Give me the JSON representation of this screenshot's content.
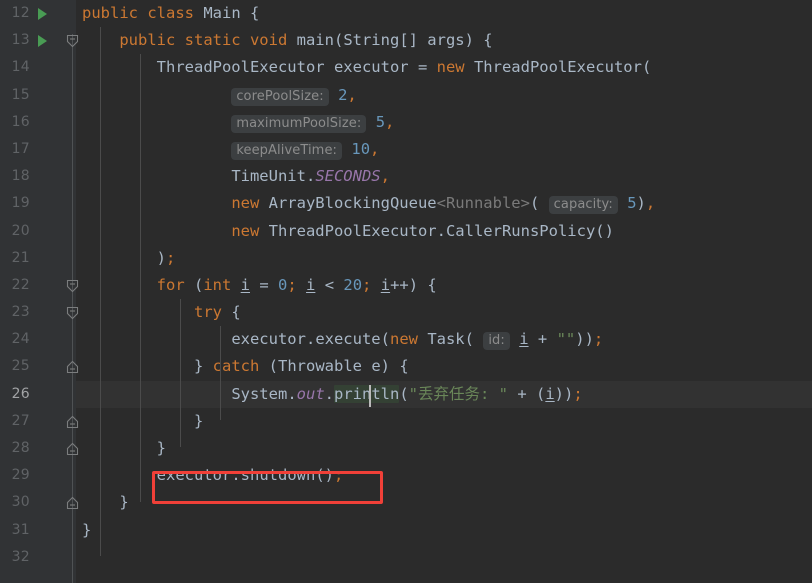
{
  "editor": {
    "language": "Java",
    "theme": "Darcula",
    "background": "#2b2b2b",
    "gutter_background": "#313335",
    "current_line_number": 26,
    "caret": {
      "line": 26,
      "column_char_index": 31,
      "after_text": "System.out.p"
    },
    "colors": {
      "keyword": "#cc7832",
      "identifier": "#a9b7c6",
      "number": "#6897bb",
      "string": "#6a8759",
      "static_field": "#9876aa",
      "generic_dim": "#7a7a7a",
      "hint_text": "#8c8c8c",
      "hint_bg": "#3c3f41",
      "line_number": "#606366",
      "current_line_number": "#a1a3a5",
      "current_line_bg": "#323232",
      "run_marker_green": "#499c54",
      "annotation_red": "#f04038",
      "indent_guide": "#4b4b4b"
    },
    "annotation": {
      "name": "red-rectangle-highlight",
      "target_line": 29,
      "target_text": "executor.shutdown();",
      "color": "#f04038"
    },
    "lines": [
      {
        "n": "12",
        "run_marker": true,
        "fold": "none",
        "text": "public class Main {"
      },
      {
        "n": "13",
        "run_marker": true,
        "fold": "start",
        "text": "    public static void main(String[] args) {"
      },
      {
        "n": "14",
        "run_marker": false,
        "fold": "none",
        "text": "        ThreadPoolExecutor executor = new ThreadPoolExecutor("
      },
      {
        "n": "15",
        "run_marker": false,
        "fold": "none",
        "text": "                corePoolSize: 2,"
      },
      {
        "n": "16",
        "run_marker": false,
        "fold": "none",
        "text": "                maximumPoolSize: 5,"
      },
      {
        "n": "17",
        "run_marker": false,
        "fold": "none",
        "text": "                keepAliveTime: 10,"
      },
      {
        "n": "18",
        "run_marker": false,
        "fold": "none",
        "text": "                TimeUnit.SECONDS,"
      },
      {
        "n": "19",
        "run_marker": false,
        "fold": "none",
        "text": "                new ArrayBlockingQueue<Runnable>( capacity: 5),"
      },
      {
        "n": "20",
        "run_marker": false,
        "fold": "none",
        "text": "                new ThreadPoolExecutor.CallerRunsPolicy()"
      },
      {
        "n": "21",
        "run_marker": false,
        "fold": "none",
        "text": "        );"
      },
      {
        "n": "22",
        "run_marker": false,
        "fold": "start",
        "text": "        for (int i = 0; i < 20; i++) {"
      },
      {
        "n": "23",
        "run_marker": false,
        "fold": "start",
        "text": "            try {"
      },
      {
        "n": "24",
        "run_marker": false,
        "fold": "none",
        "text": "                executor.execute(new Task( id: i + \"\"));"
      },
      {
        "n": "25",
        "run_marker": false,
        "fold": "end",
        "text": "            } catch (Throwable e) {"
      },
      {
        "n": "26",
        "run_marker": false,
        "fold": "none",
        "text": "                System.out.println(\"丢弃任务: \" + (i));"
      },
      {
        "n": "27",
        "run_marker": false,
        "fold": "end",
        "text": "            }"
      },
      {
        "n": "28",
        "run_marker": false,
        "fold": "end",
        "text": "        }"
      },
      {
        "n": "29",
        "run_marker": false,
        "fold": "none",
        "text": "        executor.shutdown();"
      },
      {
        "n": "30",
        "run_marker": false,
        "fold": "end",
        "text": "    }"
      },
      {
        "n": "31",
        "run_marker": false,
        "fold": "none",
        "text": "}"
      },
      {
        "n": "32",
        "run_marker": false,
        "fold": "none",
        "text": ""
      }
    ],
    "inlay_hints": [
      {
        "label": "corePoolSize:",
        "value": "2"
      },
      {
        "label": "maximumPoolSize:",
        "value": "5"
      },
      {
        "label": "keepAliveTime:",
        "value": "10"
      },
      {
        "label": "capacity:",
        "value": "5"
      },
      {
        "label": "id:",
        "value": "i"
      }
    ]
  }
}
